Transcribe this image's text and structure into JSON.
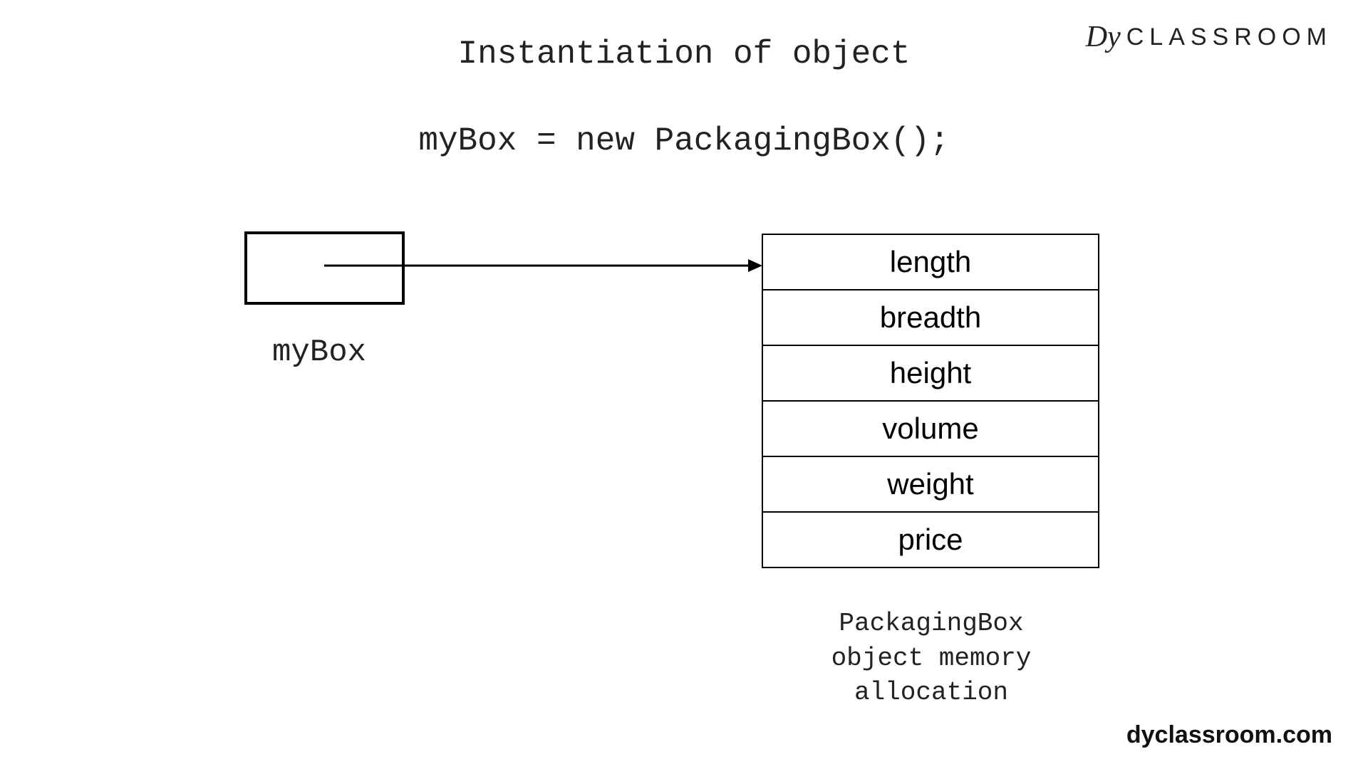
{
  "logo": {
    "script": "Dy",
    "word": "CLASSROOM"
  },
  "title": "Instantiation of object",
  "code": "myBox = new PackagingBox();",
  "varLabel": "myBox",
  "fields": [
    "length",
    "breadth",
    "height",
    "volume",
    "weight",
    "price"
  ],
  "objectCaption": "PackagingBox object memory allocation",
  "footer": "dyclassroom.com"
}
